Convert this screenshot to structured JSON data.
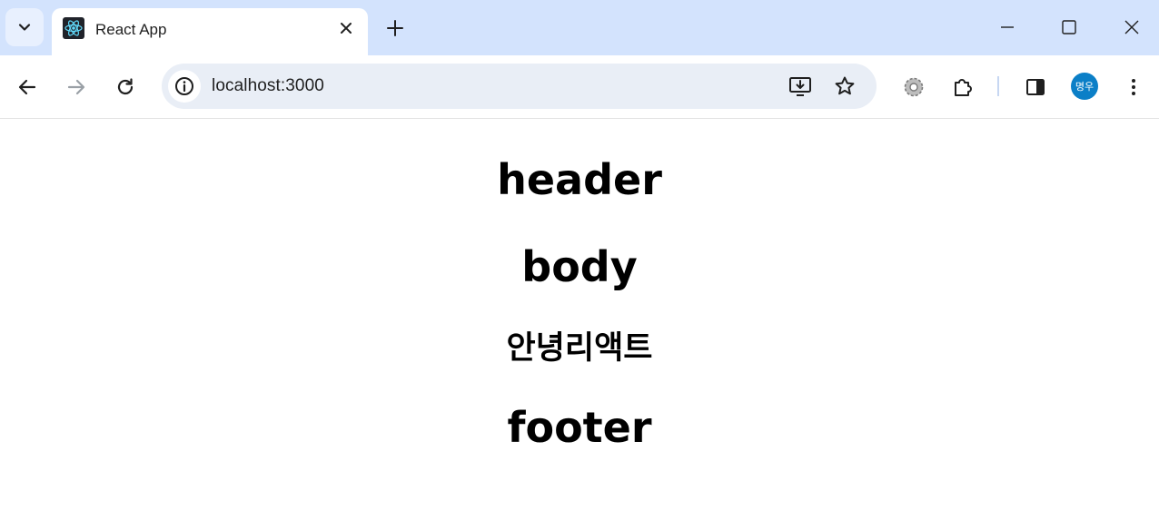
{
  "browser": {
    "tab": {
      "title": "React App"
    },
    "address_bar": {
      "url": "localhost:3000"
    },
    "profile": {
      "initials": "명우",
      "color": "#0b7fc7"
    },
    "colors": {
      "tabbar_bg": "#d3e3fd",
      "omnibox_bg": "#e9eef6"
    }
  },
  "page": {
    "header": "header",
    "body": "body",
    "greeting": "안녕리액트",
    "footer": "footer"
  }
}
